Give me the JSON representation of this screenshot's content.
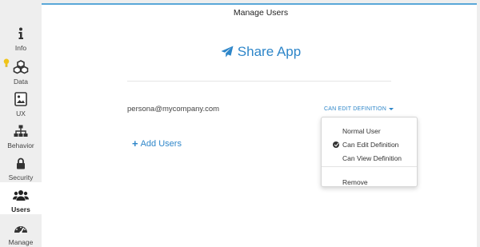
{
  "sidebar": {
    "items": [
      {
        "label": "Info",
        "icon": "info-icon"
      },
      {
        "label": "Data",
        "icon": "cubes-icon"
      },
      {
        "label": "UX",
        "icon": "image-icon"
      },
      {
        "label": "Behavior",
        "icon": "sitemap-icon"
      },
      {
        "label": "Security",
        "icon": "lock-icon"
      },
      {
        "label": "Users",
        "icon": "users-icon",
        "active": true
      },
      {
        "label": "Manage",
        "icon": "dashboard-icon"
      }
    ],
    "data_badge_icon": "lightbulb-icon",
    "badge_color": "#f0c419"
  },
  "header": {
    "title": "Manage Users"
  },
  "share": {
    "label": "Share App",
    "icon": "paper-plane-icon",
    "color": "#2e86c9"
  },
  "user_row": {
    "email": "persona@mycompany.com",
    "permission_label": "CAN EDIT DEFINITION"
  },
  "add_users": {
    "label": "Add Users"
  },
  "permission_menu": {
    "items": [
      {
        "label": "Normal User",
        "checked": false
      },
      {
        "label": "Can Edit Definition",
        "checked": true
      },
      {
        "label": "Can View Definition",
        "checked": false
      }
    ],
    "remove_label": "Remove"
  }
}
